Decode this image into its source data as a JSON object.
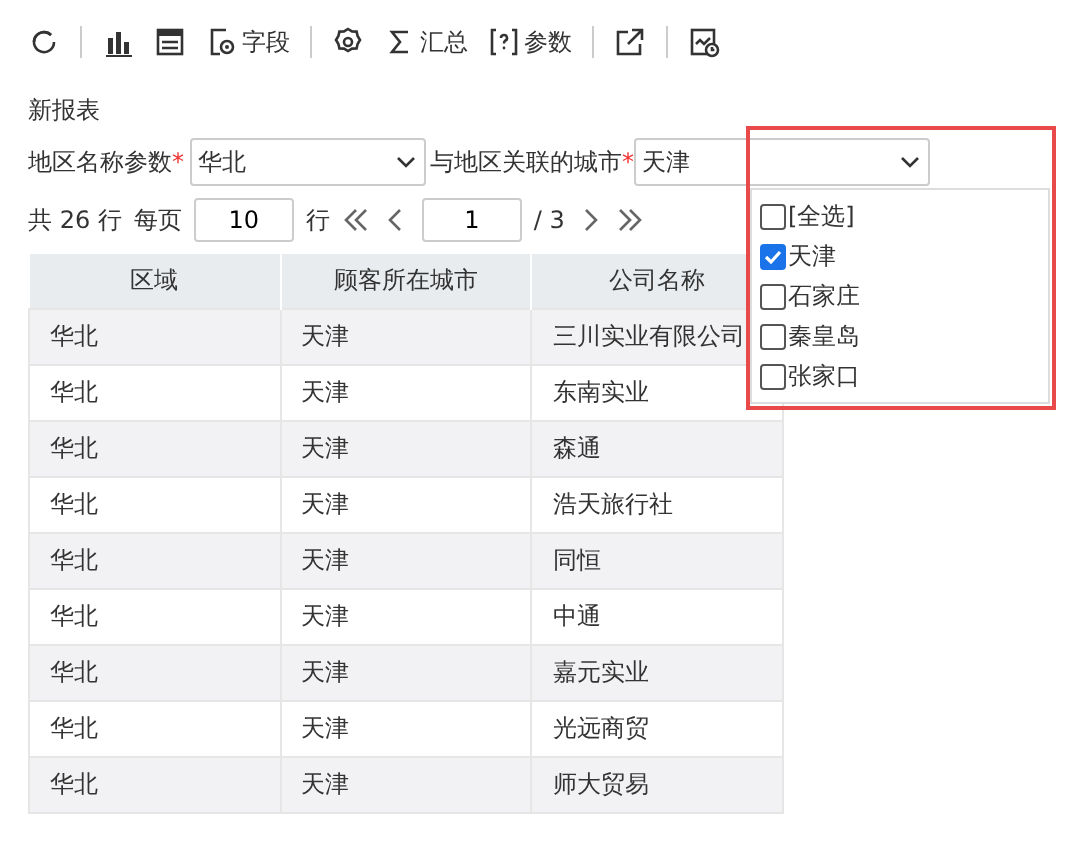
{
  "toolbar": [
    {
      "kind": "refresh"
    },
    {
      "kind": "sep"
    },
    {
      "kind": "chart"
    },
    {
      "kind": "table"
    },
    {
      "kind": "field",
      "label": "字段"
    },
    {
      "kind": "sep"
    },
    {
      "kind": "gear"
    },
    {
      "kind": "sum",
      "label": "汇总"
    },
    {
      "kind": "param",
      "label": "参数"
    },
    {
      "kind": "sep"
    },
    {
      "kind": "export"
    },
    {
      "kind": "sep"
    },
    {
      "kind": "report"
    }
  ],
  "title": "新报表",
  "params": [
    {
      "label": "地区名称参数",
      "required": "*",
      "value": "华北"
    },
    {
      "label": "与地区关联的城市",
      "required": "*",
      "value": "天津"
    }
  ],
  "dropdown": {
    "options": [
      {
        "label": "[全选]",
        "checked": false
      },
      {
        "label": "天津",
        "checked": true
      },
      {
        "label": "石家庄",
        "checked": false
      },
      {
        "label": "秦皇岛",
        "checked": false
      },
      {
        "label": "张家口",
        "checked": false
      }
    ]
  },
  "pager": {
    "total": "共 26 行",
    "per_page_label": "每页",
    "per_page": "10",
    "rows_unit": "行",
    "page": "1",
    "pages": "/ 3"
  },
  "table": {
    "columns": [
      "区域",
      "顾客所在城市",
      "公司名称"
    ],
    "rows": [
      [
        "华北",
        "天津",
        "三川实业有限公司"
      ],
      [
        "华北",
        "天津",
        "东南实业"
      ],
      [
        "华北",
        "天津",
        "森通"
      ],
      [
        "华北",
        "天津",
        "浩天旅行社"
      ],
      [
        "华北",
        "天津",
        "同恒"
      ],
      [
        "华北",
        "天津",
        "中通"
      ],
      [
        "华北",
        "天津",
        "嘉元实业"
      ],
      [
        "华北",
        "天津",
        "光远商贸"
      ],
      [
        "华北",
        "天津",
        "师大贸易"
      ]
    ]
  }
}
